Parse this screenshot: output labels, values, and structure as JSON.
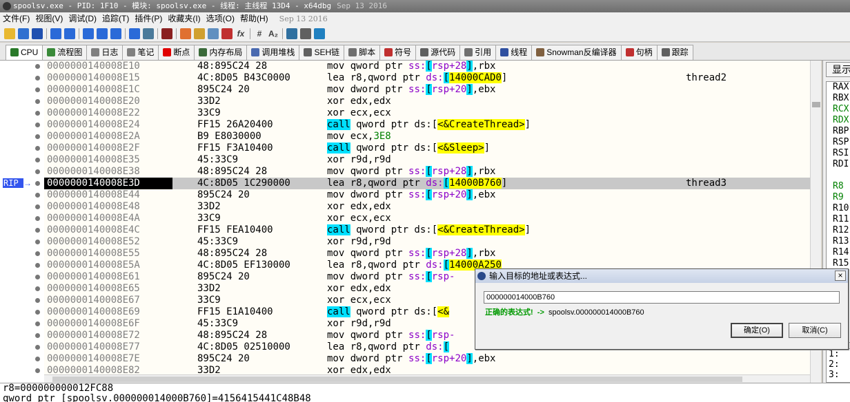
{
  "window": {
    "title": "spoolsv.exe - PID: 1F10 - 模块: spoolsv.exe - 线程: 主线程 13D4 - x64dbg",
    "date": "Sep 13 2016"
  },
  "menu": [
    "文件(F)",
    "视图(V)",
    "调试(D)",
    "追踪(T)",
    "插件(P)",
    "收藏夹(I)",
    "选项(O)",
    "帮助(H)"
  ],
  "menu_date": "Sep 13 2016",
  "toolbar": {
    "icons": [
      "open-icon",
      "restart-icon",
      "stop-icon",
      "run-icon",
      "pause-icon",
      "step-into-icon",
      "step-over-icon",
      "step-out-icon",
      "run-to-user-icon",
      "animate-icon",
      "script-icon",
      "patch-icon",
      "comment-icon",
      "label-icon",
      "bookmark-icon",
      "function-icon",
      "hash-icon",
      "font-icon",
      "settings-icon",
      "calculator-icon",
      "help-icon"
    ],
    "fx_label": "fx",
    "hash_label": "#",
    "font_label": "A₂"
  },
  "tabs": [
    {
      "label": "CPU",
      "icon": "cpu-icon",
      "color": "#2a7a2a",
      "active": true
    },
    {
      "label": "流程图",
      "icon": "graph-icon",
      "color": "#3a8a3a"
    },
    {
      "label": "日志",
      "icon": "log-icon",
      "color": "#808080"
    },
    {
      "label": "笔记",
      "icon": "notes-icon",
      "color": "#808080"
    },
    {
      "label": "断点",
      "icon": "breakpoint-icon",
      "color": "#e00000"
    },
    {
      "label": "内存布局",
      "icon": "memory-icon",
      "color": "#3a6a3a"
    },
    {
      "label": "调用堆栈",
      "icon": "callstack-icon",
      "color": "#4a6ab0"
    },
    {
      "label": "SEH链",
      "icon": "seh-icon",
      "color": "#606060"
    },
    {
      "label": "脚本",
      "icon": "script-icon",
      "color": "#707070"
    },
    {
      "label": "符号",
      "icon": "symbol-icon",
      "color": "#c03030"
    },
    {
      "label": "源代码",
      "icon": "source-icon",
      "color": "#606060"
    },
    {
      "label": "引用",
      "icon": "reference-icon",
      "color": "#707070"
    },
    {
      "label": "线程",
      "icon": "thread-icon",
      "color": "#3050a0"
    },
    {
      "label": "Snowman反编译器",
      "icon": "snowman-icon",
      "color": "#806040"
    },
    {
      "label": "句柄",
      "icon": "handle-icon",
      "color": "#c03030"
    },
    {
      "label": "跟踪",
      "icon": "trace-icon",
      "color": "#606060"
    }
  ],
  "rip_label": "RIP",
  "rip_arrow": "→",
  "disasm": [
    {
      "addr": "0000000140008E10",
      "bytes": "48:895C24 28",
      "ins": [
        [
          "mov qword ptr ",
          "t"
        ],
        [
          "ss:",
          "seg"
        ],
        [
          "[",
          "c"
        ],
        [
          "rsp+28",
          "seg"
        ],
        [
          "]",
          "c"
        ],
        [
          ",rbx",
          "t"
        ]
      ],
      "comment": ""
    },
    {
      "addr": "0000000140008E15",
      "bytes": "4C:8D05 B43C0000",
      "ins": [
        [
          "lea r8,qword ptr ",
          "t"
        ],
        [
          "ds:",
          "seg"
        ],
        [
          "[",
          "c"
        ],
        [
          "14000CAD0",
          "y"
        ],
        [
          "]",
          "t"
        ]
      ],
      "comment": "thread2"
    },
    {
      "addr": "0000000140008E1C",
      "bytes": "895C24 20",
      "ins": [
        [
          "mov dword ptr ",
          "t"
        ],
        [
          "ss:",
          "seg"
        ],
        [
          "[",
          "c"
        ],
        [
          "rsp+20",
          "seg"
        ],
        [
          "]",
          "c"
        ],
        [
          ",ebx",
          "t"
        ]
      ],
      "comment": ""
    },
    {
      "addr": "0000000140008E20",
      "bytes": "33D2",
      "ins": [
        [
          "xor edx,edx",
          "t"
        ]
      ],
      "comment": ""
    },
    {
      "addr": "0000000140008E22",
      "bytes": "33C9",
      "ins": [
        [
          "xor ecx,ecx",
          "t"
        ]
      ],
      "comment": ""
    },
    {
      "addr": "0000000140008E24",
      "bytes": "FF15 26A20400",
      "ins": [
        [
          "call",
          "c"
        ],
        [
          " qword ptr ds:[",
          "t"
        ],
        [
          "<&CreateThread>",
          "y"
        ],
        [
          "]",
          "t"
        ]
      ],
      "comment": ""
    },
    {
      "addr": "0000000140008E2A",
      "bytes": "B9 E8030000",
      "ins": [
        [
          "mov ecx,",
          "t"
        ],
        [
          "3E8",
          "g"
        ]
      ],
      "comment": ""
    },
    {
      "addr": "0000000140008E2F",
      "bytes": "FF15 F3A10400",
      "ins": [
        [
          "call",
          "c"
        ],
        [
          " qword ptr ds:[",
          "t"
        ],
        [
          "<&Sleep>",
          "y"
        ],
        [
          "]",
          "t"
        ]
      ],
      "comment": ""
    },
    {
      "addr": "0000000140008E35",
      "bytes": "45:33C9",
      "ins": [
        [
          "xor r9d,r9d",
          "t"
        ]
      ],
      "comment": ""
    },
    {
      "addr": "0000000140008E38",
      "bytes": "48:895C24 28",
      "ins": [
        [
          "mov qword ptr ",
          "t"
        ],
        [
          "ss:",
          "seg"
        ],
        [
          "[",
          "c"
        ],
        [
          "rsp+28",
          "seg"
        ],
        [
          "]",
          "c"
        ],
        [
          ",rbx",
          "t"
        ]
      ],
      "comment": ""
    },
    {
      "addr": "0000000140008E3D",
      "bytes": "4C:8D05 1C290000",
      "ins": [
        [
          "lea r8,qword ptr ",
          "t"
        ],
        [
          "ds:",
          "seg"
        ],
        [
          "[",
          "c"
        ],
        [
          "14000B760",
          "y"
        ],
        [
          "]",
          "t"
        ]
      ],
      "comment": "thread3",
      "sel": true
    },
    {
      "addr": "0000000140008E44",
      "bytes": "895C24 20",
      "ins": [
        [
          "mov dword ptr ",
          "t"
        ],
        [
          "ss:",
          "seg"
        ],
        [
          "[",
          "c"
        ],
        [
          "rsp+20",
          "seg"
        ],
        [
          "]",
          "c"
        ],
        [
          ",ebx",
          "t"
        ]
      ],
      "comment": ""
    },
    {
      "addr": "0000000140008E48",
      "bytes": "33D2",
      "ins": [
        [
          "xor edx,edx",
          "t"
        ]
      ],
      "comment": ""
    },
    {
      "addr": "0000000140008E4A",
      "bytes": "33C9",
      "ins": [
        [
          "xor ecx,ecx",
          "t"
        ]
      ],
      "comment": ""
    },
    {
      "addr": "0000000140008E4C",
      "bytes": "FF15 FEA10400",
      "ins": [
        [
          "call",
          "c"
        ],
        [
          " qword ptr ds:[",
          "t"
        ],
        [
          "<&CreateThread>",
          "y"
        ],
        [
          "]",
          "t"
        ]
      ],
      "comment": ""
    },
    {
      "addr": "0000000140008E52",
      "bytes": "45:33C9",
      "ins": [
        [
          "xor r9d,r9d",
          "t"
        ]
      ],
      "comment": ""
    },
    {
      "addr": "0000000140008E55",
      "bytes": "48:895C24 28",
      "ins": [
        [
          "mov qword ptr ",
          "t"
        ],
        [
          "ss:",
          "seg"
        ],
        [
          "[",
          "c"
        ],
        [
          "rsp+28",
          "seg"
        ],
        [
          "]",
          "c"
        ],
        [
          ",rbx",
          "t"
        ]
      ],
      "comment": ""
    },
    {
      "addr": "0000000140008E5A",
      "bytes": "4C:8D05 EF130000",
      "ins": [
        [
          "lea r8,qword ptr ",
          "t"
        ],
        [
          "ds:",
          "seg"
        ],
        [
          "[",
          "c"
        ],
        [
          "14000A250",
          "y"
        ]
      ],
      "comment": ""
    },
    {
      "addr": "0000000140008E61",
      "bytes": "895C24 20",
      "ins": [
        [
          "mov dword ptr ",
          "t"
        ],
        [
          "ss:",
          "seg"
        ],
        [
          "[",
          "c"
        ],
        [
          "rsp-",
          "seg"
        ]
      ],
      "comment": ""
    },
    {
      "addr": "0000000140008E65",
      "bytes": "33D2",
      "ins": [
        [
          "xor edx,edx",
          "t"
        ]
      ],
      "comment": ""
    },
    {
      "addr": "0000000140008E67",
      "bytes": "33C9",
      "ins": [
        [
          "xor ecx,ecx",
          "t"
        ]
      ],
      "comment": ""
    },
    {
      "addr": "0000000140008E69",
      "bytes": "FF15 E1A10400",
      "ins": [
        [
          "call",
          "c"
        ],
        [
          " qword ptr ds:[",
          "t"
        ],
        [
          "<&",
          "y"
        ]
      ],
      "comment": ""
    },
    {
      "addr": "0000000140008E6F",
      "bytes": "45:33C9",
      "ins": [
        [
          "xor r9d,r9d",
          "t"
        ]
      ],
      "comment": ""
    },
    {
      "addr": "0000000140008E72",
      "bytes": "48:895C24 28",
      "ins": [
        [
          "mov qword ptr ",
          "t"
        ],
        [
          "ss:",
          "seg"
        ],
        [
          "[",
          "c"
        ],
        [
          "rsp-",
          "seg"
        ]
      ],
      "comment": ""
    },
    {
      "addr": "0000000140008E77",
      "bytes": "4C:8D05 02510000",
      "ins": [
        [
          "lea r8,qword ptr ",
          "t"
        ],
        [
          "ds:",
          "seg"
        ],
        [
          "[",
          "c"
        ]
      ],
      "comment": ""
    },
    {
      "addr": "0000000140008E7E",
      "bytes": "895C24 20",
      "ins": [
        [
          "mov dword ptr ",
          "t"
        ],
        [
          "ss:",
          "seg"
        ],
        [
          "[",
          "c"
        ],
        [
          "rsp+20",
          "seg"
        ],
        [
          "]",
          "c"
        ],
        [
          ",ebx",
          "t"
        ]
      ],
      "comment": ""
    },
    {
      "addr": "0000000140008E82",
      "bytes": "33D2",
      "ins": [
        [
          "xor edx,edx",
          "t"
        ]
      ],
      "comment": ""
    }
  ],
  "right_panel": {
    "button": "显示",
    "registers": [
      {
        "name": "RAX",
        "color": "#000000"
      },
      {
        "name": "RBX",
        "color": "#000000"
      },
      {
        "name": "RCX",
        "color": "#008000"
      },
      {
        "name": "RDX",
        "color": "#008000"
      },
      {
        "name": "RBP",
        "color": "#000000"
      },
      {
        "name": "RSP",
        "color": "#000000"
      },
      {
        "name": "RSI",
        "color": "#000000"
      },
      {
        "name": "RDI",
        "color": "#000000"
      },
      {
        "name": "",
        "color": "#000000"
      },
      {
        "name": "R8",
        "color": "#008000"
      },
      {
        "name": "R9",
        "color": "#008000"
      },
      {
        "name": "R10",
        "color": "#000000"
      },
      {
        "name": "R11",
        "color": "#000000"
      },
      {
        "name": "R12",
        "color": "#000000"
      },
      {
        "name": "R13",
        "color": "#000000"
      },
      {
        "name": "R14",
        "color": "#000000"
      },
      {
        "name": "R15",
        "color": "#000000"
      }
    ],
    "stack": [
      "1:",
      "2:",
      "3:"
    ]
  },
  "status": {
    "line1": "r8=000000000012FC88",
    "line2": "qword ptr [spoolsv.000000014000B760]=4156415441C48B48"
  },
  "dialog": {
    "title": "输入目标的地址或表达式...",
    "close": "×",
    "input_value": "000000014000B760",
    "ok_text": "正确的表达式!",
    "arrow": "->",
    "resolved": "spoolsv.000000014000B760",
    "ok_button": "确定(O)",
    "cancel_button": "取消(C)"
  }
}
